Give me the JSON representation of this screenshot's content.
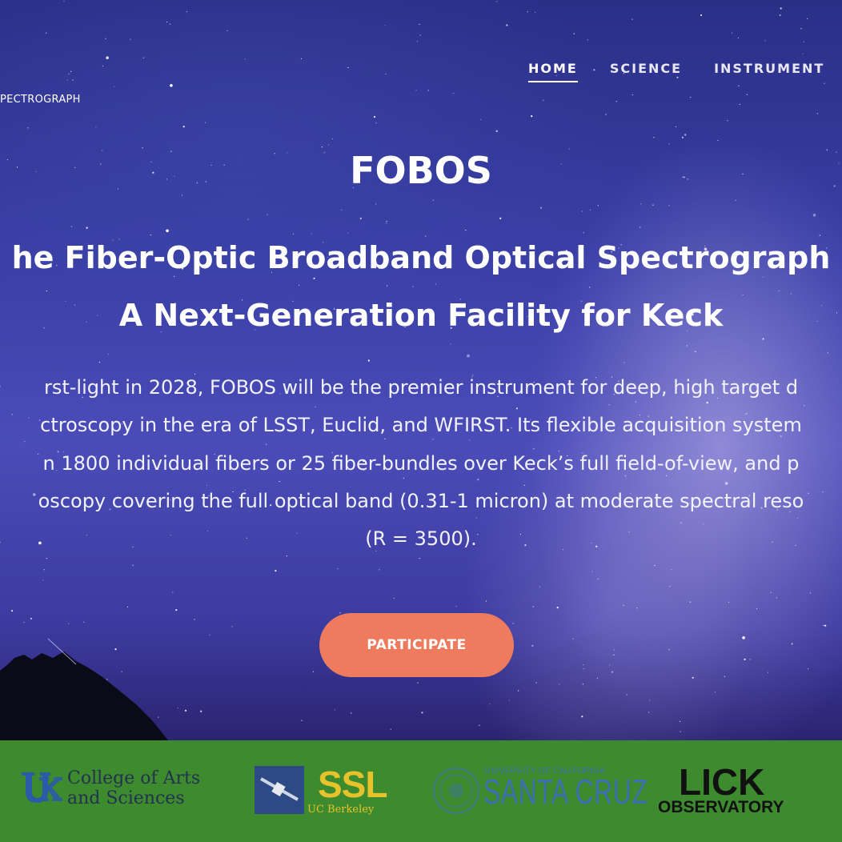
{
  "header": {
    "brand_fragment": "PECTROGRAPH",
    "nav": [
      {
        "label": "HOME",
        "active": true
      },
      {
        "label": "SCIENCE",
        "active": false
      },
      {
        "label": "INSTRUMENT",
        "active": false
      }
    ]
  },
  "hero": {
    "title": "FOBOS",
    "subtitle_line1": "he Fiber-Optic Broadband Optical Spectrograph",
    "subtitle_line2": "A Next-Generation Facility for Keck",
    "description_lines": [
      "rst-light in 2028, FOBOS will be the premier instrument for deep, high target d",
      "ctroscopy in the era of LSST, Euclid, and WFIRST. Its flexible acquisition system",
      "n 1800 individual fibers or 25 fiber-bundles over Keck’s full field-of-view, and p",
      "oscopy covering the full optical band (0.31-1 micron) at moderate spectral reso",
      "(R = 3500)."
    ],
    "cta_label": "PARTICIPATE"
  },
  "footer": {
    "logos": {
      "uk": {
        "line1": "College of Arts",
        "line2": "and Sciences",
        "mark": "UK"
      },
      "ssl": {
        "main": "SSL",
        "sub": "UC Berkeley"
      },
      "ucsc": {
        "small": "UNIVERSITY OF CALIFORNIA",
        "big": "SANTA CRUZ"
      },
      "lick": {
        "main": "LICK",
        "sub": "OBSERVATORY"
      }
    }
  },
  "colors": {
    "cta": "#ee7b5d",
    "footer_bg": "#3d8a2f",
    "sky": "#3a3fa6"
  }
}
